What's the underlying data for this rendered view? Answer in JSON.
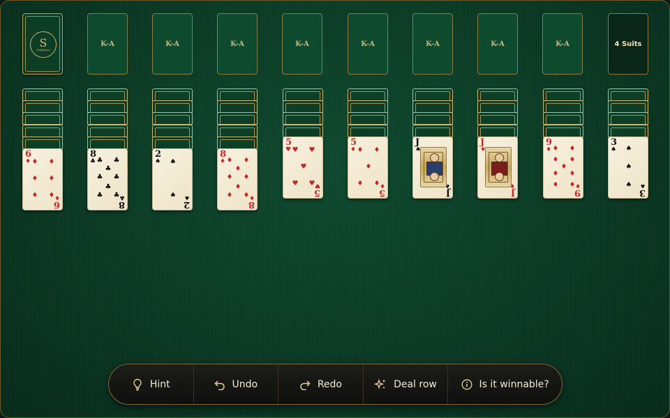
{
  "stock": {
    "emblem_letter": "S",
    "emblem_name": "Solitaires"
  },
  "foundations": [
    {
      "label": "K-A"
    },
    {
      "label": "K-A"
    },
    {
      "label": "K-A"
    },
    {
      "label": "K-A"
    },
    {
      "label": "K-A"
    },
    {
      "label": "K-A"
    },
    {
      "label": "K-A"
    },
    {
      "label": "K-A"
    }
  ],
  "mode": {
    "label": "4 Suits"
  },
  "tableau": [
    {
      "facedown": 5,
      "top": {
        "rank": "6",
        "suit": "♦",
        "color": "red"
      }
    },
    {
      "facedown": 5,
      "top": {
        "rank": "8",
        "suit": "♣",
        "color": "black"
      }
    },
    {
      "facedown": 5,
      "top": {
        "rank": "2",
        "suit": "♠",
        "color": "black"
      }
    },
    {
      "facedown": 5,
      "top": {
        "rank": "8",
        "suit": "♦",
        "color": "red"
      }
    },
    {
      "facedown": 4,
      "top": {
        "rank": "5",
        "suit": "♥",
        "color": "red"
      }
    },
    {
      "facedown": 4,
      "top": {
        "rank": "5",
        "suit": "♦",
        "color": "red"
      }
    },
    {
      "facedown": 4,
      "top": {
        "rank": "J",
        "suit": "♠",
        "color": "black"
      }
    },
    {
      "facedown": 4,
      "top": {
        "rank": "J",
        "suit": "♦",
        "color": "red"
      }
    },
    {
      "facedown": 4,
      "top": {
        "rank": "9",
        "suit": "♦",
        "color": "red"
      }
    },
    {
      "facedown": 4,
      "top": {
        "rank": "3",
        "suit": "♠",
        "color": "black"
      }
    }
  ],
  "toolbar": {
    "hint": "Hint",
    "undo": "Undo",
    "redo": "Redo",
    "deal": "Deal row",
    "winnable": "Is it winnable?"
  },
  "icons": {
    "hint": "lightbulb-icon",
    "undo": "undo-arrow-icon",
    "redo": "redo-arrow-icon",
    "deal": "sparkles-icon",
    "winnable": "info-icon"
  },
  "colors": {
    "felt": "#0b3a25",
    "gold": "#b8a35e",
    "red": "#c62828",
    "black": "#111111",
    "card": "#f4ecd6"
  }
}
